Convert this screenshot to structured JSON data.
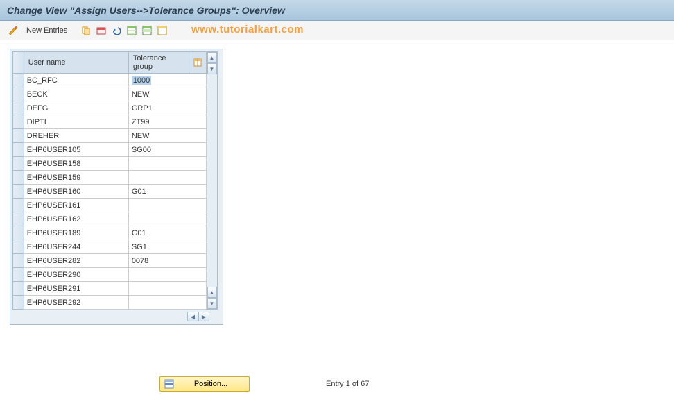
{
  "header": {
    "title": "Change View \"Assign Users-->Tolerance Groups\": Overview"
  },
  "toolbar": {
    "new_entries": "New Entries"
  },
  "watermark": "www.tutorialkart.com",
  "table": {
    "headers": {
      "user": "User name",
      "tol": "Tolerance group"
    },
    "rows": [
      {
        "user": "BC_RFC",
        "tol": "1000",
        "selected": true
      },
      {
        "user": "BECK",
        "tol": "NEW"
      },
      {
        "user": "DEFG",
        "tol": "GRP1"
      },
      {
        "user": "DIPTI",
        "tol": "ZT99"
      },
      {
        "user": "DREHER",
        "tol": "NEW"
      },
      {
        "user": "EHP6USER105",
        "tol": "SG00"
      },
      {
        "user": "EHP6USER158",
        "tol": ""
      },
      {
        "user": "EHP6USER159",
        "tol": ""
      },
      {
        "user": "EHP6USER160",
        "tol": "G01"
      },
      {
        "user": "EHP6USER161",
        "tol": ""
      },
      {
        "user": "EHP6USER162",
        "tol": ""
      },
      {
        "user": "EHP6USER189",
        "tol": "G01"
      },
      {
        "user": "EHP6USER244",
        "tol": "SG1"
      },
      {
        "user": "EHP6USER282",
        "tol": "0078"
      },
      {
        "user": "EHP6USER290",
        "tol": ""
      },
      {
        "user": "EHP6USER291",
        "tol": ""
      },
      {
        "user": "EHP6USER292",
        "tol": ""
      }
    ]
  },
  "footer": {
    "position_label": "Position...",
    "entry_status": "Entry 1 of 67"
  }
}
